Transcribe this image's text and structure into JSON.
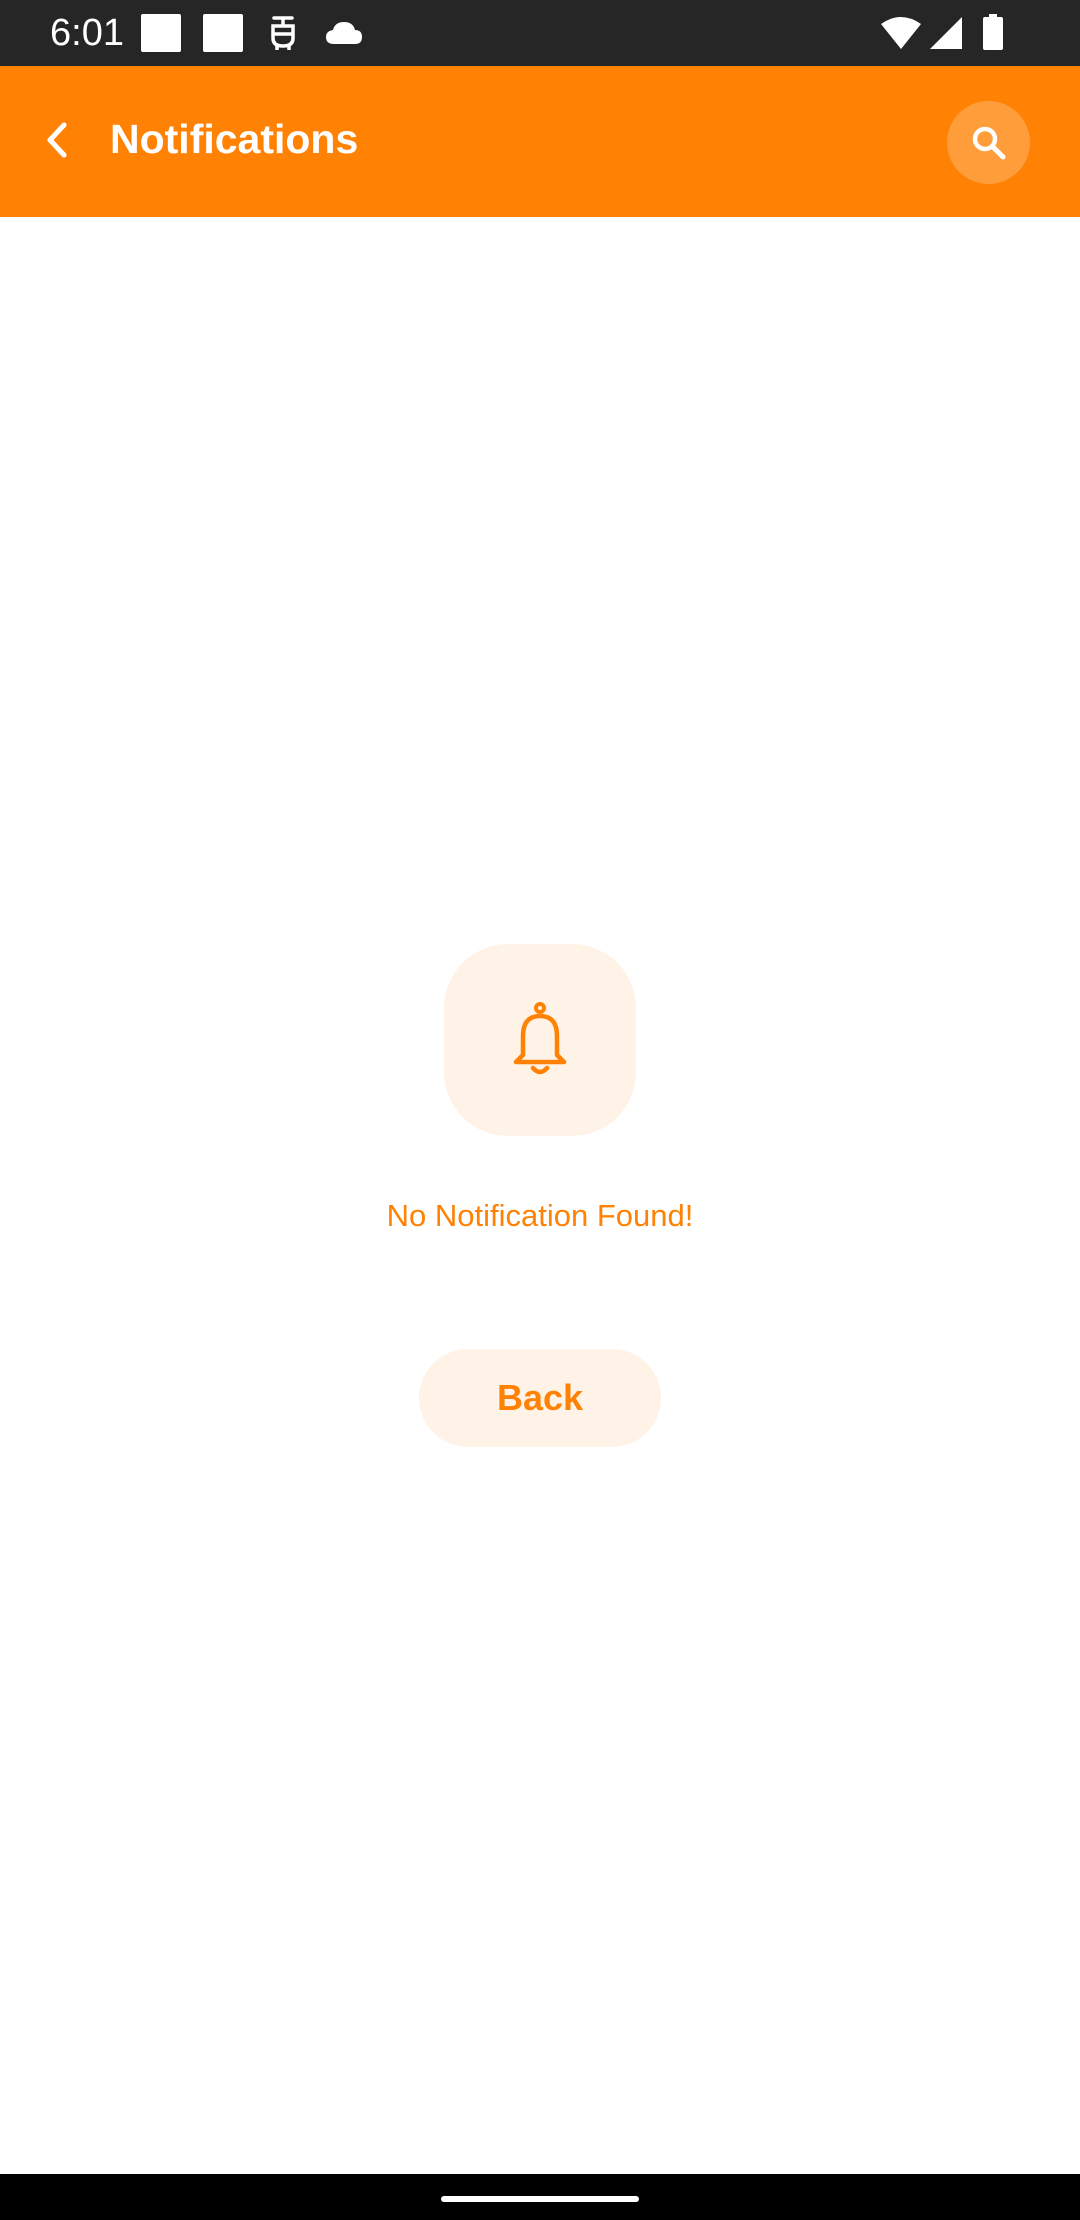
{
  "status_bar": {
    "time": "6:01",
    "icons": [
      "notification-square-icon",
      "notification-square-icon",
      "assistant-icon",
      "cloud-icon",
      "wifi-icon",
      "signal-icon",
      "battery-icon"
    ]
  },
  "app_bar": {
    "title": "Notifications",
    "back_icon": "chevron-left-icon",
    "search_icon": "search-icon"
  },
  "empty_state": {
    "icon": "bell-icon",
    "message": "No Notification Found!",
    "button_label": "Back"
  },
  "colors": {
    "accent": "#ff8205",
    "accent_light": "#fff2e6",
    "status_bar_bg": "#262626",
    "nav_bar_bg": "#000000",
    "background": "#ffffff"
  }
}
